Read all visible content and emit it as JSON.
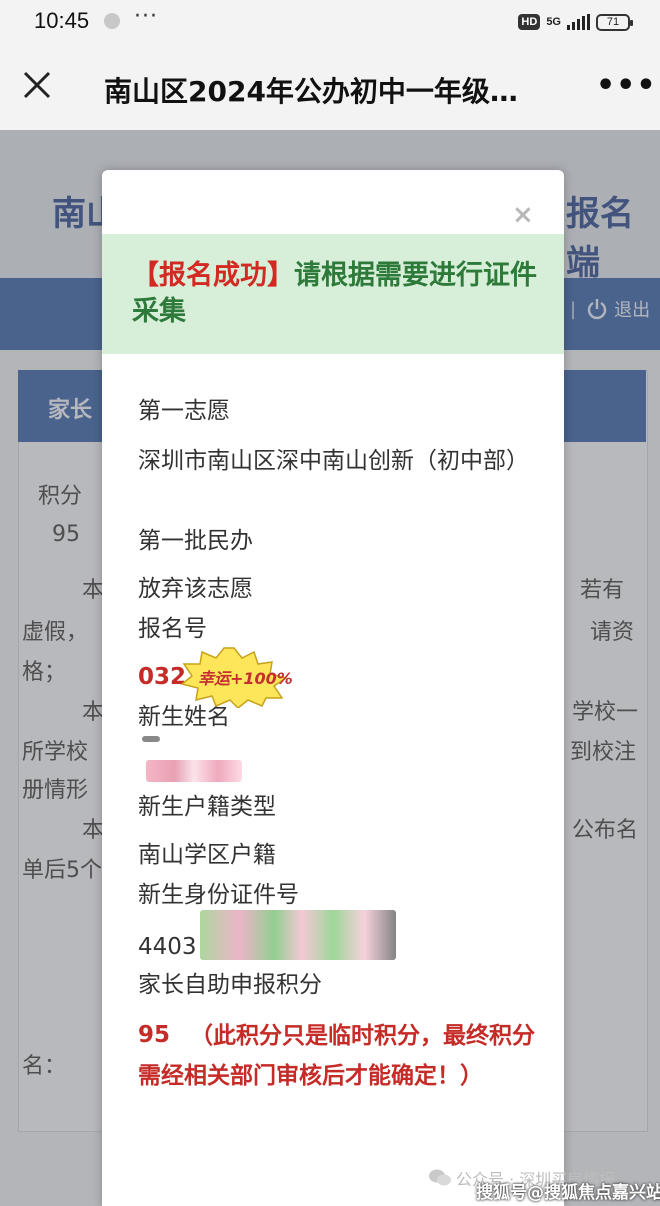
{
  "status_bar": {
    "time": "10:45",
    "network_badge": "HD",
    "network_type": "5G",
    "battery": "71"
  },
  "nav": {
    "title": "南山区2024年公办初中一年级…",
    "close_icon": "close-icon",
    "more_icon": "more-icon",
    "more_label": "•••"
  },
  "background_page": {
    "heading_left": "南山",
    "heading_right": "报名端",
    "logout": "退出",
    "logout_separator": "|",
    "panel_header": "家长",
    "score_label": "积分",
    "score_value": "95",
    "frag_1": "本",
    "frag_2": "若有",
    "frag_3": "虚假，",
    "frag_4": "请资",
    "frag_5": "格；",
    "frag_6": "本",
    "frag_7": "学校一",
    "frag_8": "所学校",
    "frag_9": "到校注",
    "frag_10": "册情形",
    "frag_11": "本",
    "frag_12": "公布名",
    "frag_13": "单后5个",
    "frag_14": "名："
  },
  "modal": {
    "close_label": "×",
    "success_tag": "【报名成功】",
    "success_message": "请根据需要进行证件采集",
    "fields": {
      "choice_label": "第一志愿",
      "school_value": "深圳市南山区深中南山创新（初中部）",
      "batch_value": "第一批民办",
      "abandon_label": "放弃该志愿",
      "reg_no_label": "报名号",
      "reg_no_value": "032",
      "name_label": "新生姓名",
      "hukou_label": "新生户籍类型",
      "hukou_value": "南山学区户籍",
      "id_label": "新生身份证件号",
      "id_value": "4403",
      "points_label": "家长自助申报积分",
      "points_value": "95",
      "points_remark": "（此积分只是临时积分，最终积分需经相关部门审核后才能确定！）"
    },
    "sticker_text": "幸运+100%"
  },
  "watermarks": {
    "public_account": "公众号 · 深圳买房情报",
    "brand": "搜狐号@搜狐焦点嘉兴站"
  },
  "colors": {
    "success_green": "#2e7a3a",
    "success_bg": "#d7eed9",
    "alert_red": "#c52b27",
    "bg_blue": "#2c5aa0"
  }
}
